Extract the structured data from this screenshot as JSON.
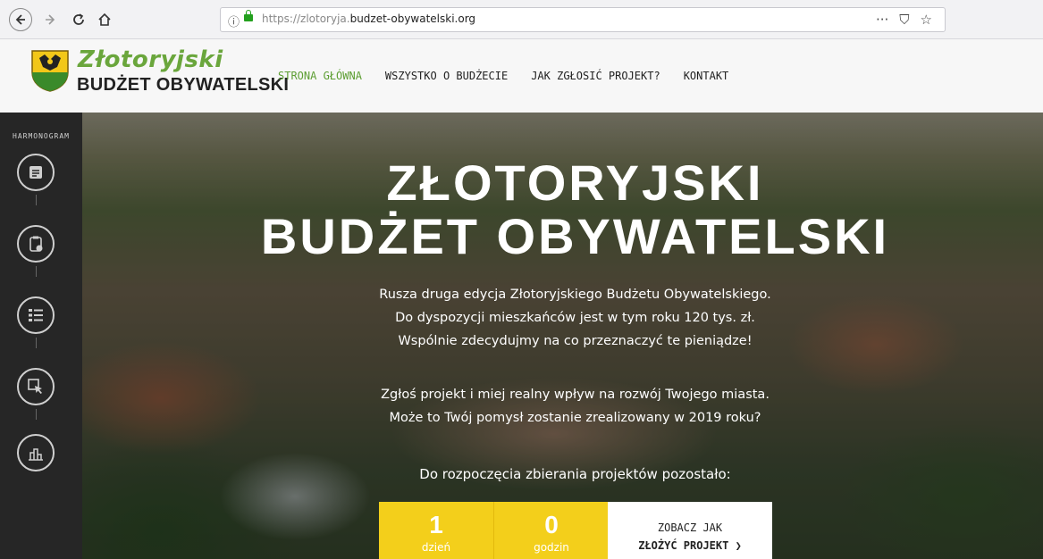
{
  "browser": {
    "url_prefix": "https://zlotoryja.",
    "url_domain": "budzet-obywatelski.org",
    "info_icon": "ⓘ",
    "actions": [
      "···",
      "⛉",
      "☆"
    ]
  },
  "header": {
    "logo_title": "Złotoryjski",
    "logo_subtitle": "BUDŻET OBYWATELSKI",
    "menu": [
      {
        "label": "STRONA GŁÓWNA",
        "active": true
      },
      {
        "label": "WSZYSTKO O BUDŻECIE",
        "active": false
      },
      {
        "label": "JAK ZGŁOSIĆ PROJEKT?",
        "active": false
      },
      {
        "label": "KONTAKT",
        "active": false
      }
    ]
  },
  "sidebar": {
    "label": "HARMONOGRAM",
    "icons": [
      "form-icon",
      "clipboard-check-icon",
      "list-icon",
      "cursor-select-icon",
      "vote-icon"
    ]
  },
  "hero": {
    "title_line1": "ZŁOTORYJSKI",
    "title_line2": "BUDŻET OBYWATELSKI",
    "paragraph1": [
      "Rusza druga edycja Złotoryjskiego Budżetu Obywatelskiego.",
      "Do dyspozycji mieszkańców jest w tym roku 120 tys. zł.",
      "Wspólnie zdecydujmy na co przeznaczyć te pieniądze!"
    ],
    "paragraph2": [
      "Zgłoś projekt i miej realny wpływ na rozwój Twojego miasta.",
      "Może to Twój pomysł zostanie zrealizowany w 2019 roku?"
    ],
    "countdown_label": "Do rozpoczęcia zbierania projektów pozostało:",
    "counters": [
      {
        "value": "1",
        "unit": "dzień"
      },
      {
        "value": "0",
        "unit": "godzin"
      }
    ],
    "cta_line1": "ZOBACZ JAK",
    "cta_line2": "ZŁOŻYĆ PROJEKT ❯"
  },
  "colors": {
    "brand_green": "#6aa63c",
    "counter_yellow": "#f3cf1b",
    "sidebar_bg": "#262626"
  }
}
